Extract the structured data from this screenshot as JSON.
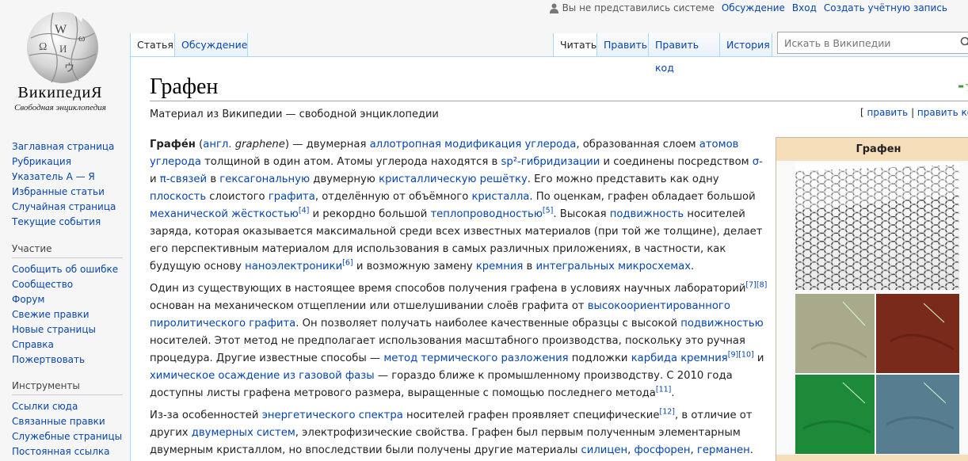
{
  "logo": {
    "wordmark": "ВикипедиЯ",
    "tagline": "Свободная энциклопедия"
  },
  "personal": {
    "anon": "Вы не представились системе",
    "talk": "Обсуждение",
    "login": "Вход",
    "create": "Создать учётную запись"
  },
  "tabs": {
    "article": "Статья",
    "discussion": "Обсуждение",
    "read": "Читать",
    "edit": "Править",
    "edit_source": "Править код",
    "history": "История"
  },
  "search": {
    "placeholder": "Искать в Википедии"
  },
  "nav": {
    "main": [
      "Заглавная страница",
      "Рубрикация",
      "Указатель А — Я",
      "Избранные статьи",
      "Случайная страница",
      "Текущие события"
    ],
    "participation_heading": "Участие",
    "participation": [
      "Сообщить об ошибке",
      "Сообщество",
      "Форум",
      "Свежие правки",
      "Новые страницы",
      "Справка",
      "Пожертвовать"
    ],
    "tools_heading": "Инструменты",
    "tools": [
      "Ссылки сюда",
      "Связанные правки",
      "Служебные страницы",
      "Постоянная ссылка"
    ]
  },
  "page": {
    "title": "Графен",
    "star": "-☆",
    "tagline": "Материал из Википедии — свободной энциклопедии",
    "edit_link": "править",
    "edit_source_link": "править код",
    "bracket_open": "[ ",
    "separator": " | ",
    "bracket_close": " ]"
  },
  "infobox": {
    "title": "Графен"
  },
  "article": {
    "p1": {
      "t01": "Графе́н",
      "t02": " (",
      "t03": "англ.",
      "t04": " ",
      "t05": "graphene",
      "t06": ") — двумерная ",
      "l01": "аллотропная модификация углерода",
      "t07": ", образованная слоем ",
      "l02": "атомов углерода",
      "t08": " толщиной в один атом. Атомы углерода находятся в ",
      "l03": "sp²-гибридизации",
      "t09": " и соединены посредством ",
      "l04": "σ-",
      "t10": " и ",
      "l05": "π-связей",
      "t11": " в ",
      "l06": "гексагональную",
      "t12": " двумерную ",
      "l07": "кристаллическую решётку",
      "t13": ". Его можно представить как одну ",
      "l08": "плоскость",
      "t14": " слоистого ",
      "l09": "графита",
      "t15": ", отделённую от объёмного ",
      "l10": "кристалла",
      "t16": ". По оценкам, графен обладает большой ",
      "l11": "механической жёсткостью",
      "s01": "[4]",
      "t17": " и рекордно большой ",
      "l12": "теплопроводностью",
      "s02": "[5]",
      "t18": ". Высокая ",
      "l13": "подвижность",
      "t19": " носителей заряда, которая оказывается максимальной среди всех известных материалов (при той же толщине), делает его перспективным материалом для использования в самых различных приложениях, в частности, как будущую основу ",
      "l14": "наноэлектроники",
      "s03": "[6]",
      "t20": " и возможную замену ",
      "l15": "кремния",
      "t21": " в ",
      "l16": "интегральных микросхемах",
      "t22": "."
    },
    "p2": {
      "t01": "Один из существующих в настоящее время способов получения графена в условиях научных лабораторий",
      "s01": "[7]",
      "s02": "[8]",
      "t02": " основан на механическом отщеплении или отшелушивании слоёв графита от ",
      "l01": "высокоориентированного пиролитического графита",
      "t03": ". Он позволяет получать наиболее качественные образцы с высокой ",
      "l02": "подвижностью",
      "t04": " носителей. Этот метод не предполагает использования масштабного производства, поскольку это ручная процедура. Другие известные способы — ",
      "l03": "метод термического разложения",
      "t05": " подложки ",
      "l04": "карбида кремния",
      "s03": "[9]",
      "s04": "[10]",
      "t06": " и ",
      "l05": "химическое осаждение из газовой фазы",
      "t07": " — гораздо ближе к промышленному производству. С 2010 года доступны листы графена метрового размера, выращенные с помощью последнего метода",
      "s05": "[11]",
      "t08": "."
    },
    "p3": {
      "t01": "Из-за особенностей ",
      "l01": "энергетического спектра",
      "t02": " носителей графен проявляет специфические",
      "s01": "[12]",
      "t03": ", в отличие от других ",
      "l02": "двумерных систем",
      "t04": ", электрофизические свойства. Графен был первым полученным элементарным двумерным кристаллом, но впоследствии были получены другие материалы ",
      "l03": "силицен",
      "t05": ", ",
      "l04": "фосфорен",
      "t06": ", ",
      "l05": "германен",
      "t07": "."
    }
  }
}
